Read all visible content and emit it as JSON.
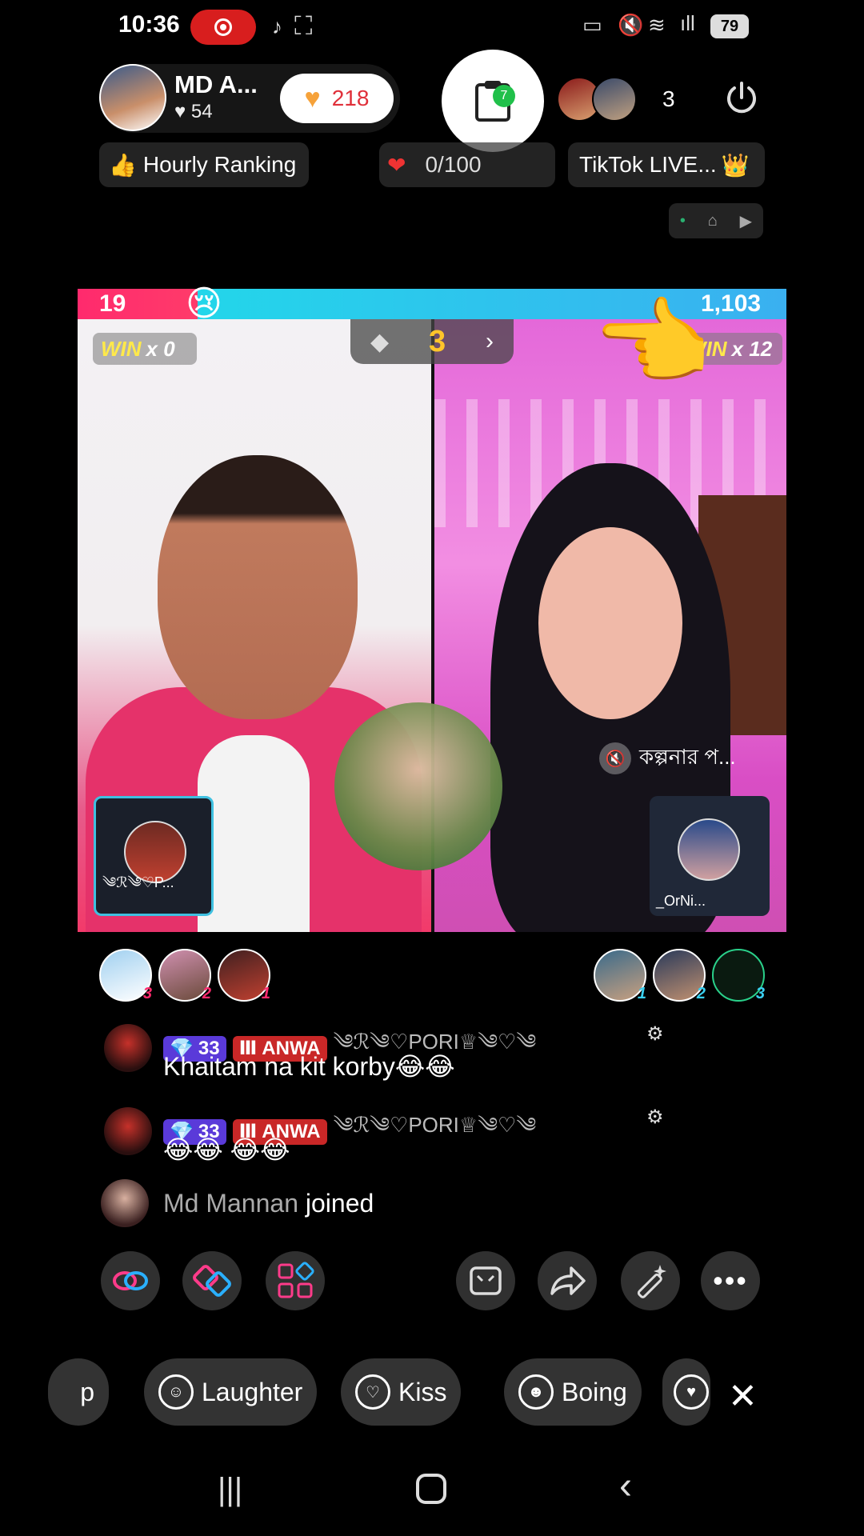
{
  "status_bar": {
    "time": "10:36",
    "battery": "79"
  },
  "host": {
    "name": "MD A...",
    "likes": "54",
    "follow_count": "218",
    "clip_badge": "7"
  },
  "viewers": {
    "count": "3"
  },
  "pills": {
    "hourly_ranking": "Hourly Ranking",
    "quest_progress": "0/100",
    "tiktok_live": "TikTok LIVE..."
  },
  "battle": {
    "left_score": "19",
    "right_score": "1,103",
    "left_win_label": "WIN",
    "left_win_count": "x 0",
    "right_win_label": "WIN",
    "right_win_count": "x 12",
    "round": "3",
    "left_pip_label": "༄ℛ༄♡P...",
    "right_pip_label": "_OrNi...",
    "mute_label": "কল্পনার প..."
  },
  "supporters": {
    "left": [
      "3",
      "2",
      "1"
    ],
    "right": [
      "1",
      "2",
      "3"
    ]
  },
  "chat": [
    {
      "gem_level": "33",
      "fan_badge": "ANWA",
      "name": "༄ℛ༄♡PORI♕༄♡༄",
      "text": "Khaitam na kit korby😂😂"
    },
    {
      "gem_level": "33",
      "fan_badge": "ANWA",
      "name": "༄ℛ༄♡PORI♕༄♡༄",
      "text": "😂😂 😂😂"
    }
  ],
  "join": {
    "name": "Md Mannan",
    "action": "joined"
  },
  "reactions": {
    "partial_left": "p",
    "laughter": "Laughter",
    "kiss": "Kiss",
    "boing": "Boing"
  },
  "colors": {
    "score_left": "#ff2a6d",
    "score_right": "#23d6ea",
    "win_yellow": "#ffe94a",
    "round_yellow": "#ffc52a"
  }
}
